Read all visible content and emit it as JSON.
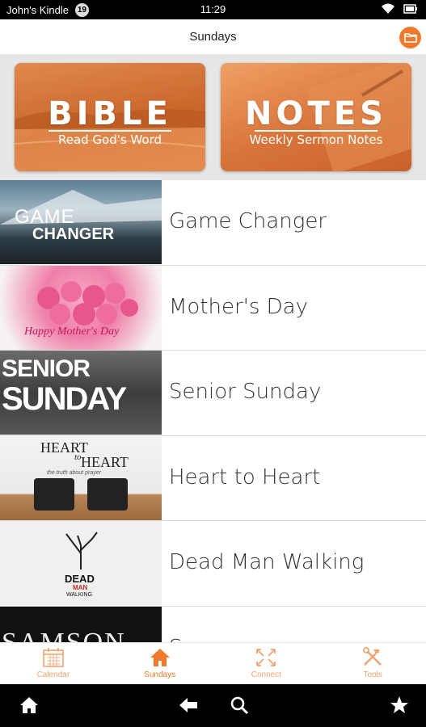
{
  "status_bar": {
    "device_name": "John's Kindle",
    "notification_count": "19",
    "time": "11:29"
  },
  "header": {
    "title": "Sundays",
    "folder_icon": "folder-icon"
  },
  "banner": {
    "bible": {
      "title": "BIBLE",
      "subtitle": "Read God's Word"
    },
    "notes": {
      "title": "NOTES",
      "subtitle": "Weekly Sermon Notes"
    }
  },
  "series": [
    {
      "label": "Game Changer",
      "thumb_text": [
        "GAME",
        "CHANGER"
      ]
    },
    {
      "label": "Mother's Day",
      "thumb_text": [
        "Happy Mother's Day"
      ]
    },
    {
      "label": "Senior Sunday",
      "thumb_text": [
        "SENIOR",
        "SUNDAY"
      ]
    },
    {
      "label": "Heart to Heart",
      "thumb_text": [
        "HEART",
        "to",
        "HEART",
        "the truth about prayer"
      ]
    },
    {
      "label": "Dead Man Walking",
      "thumb_text": [
        "DEAD",
        "MAN",
        "WALKING"
      ]
    },
    {
      "label": "Samson",
      "thumb_text": [
        "SAMSON"
      ]
    }
  ],
  "tabs": [
    {
      "label": "Calendar",
      "icon": "calendar-icon",
      "active": false
    },
    {
      "label": "Sundays",
      "icon": "home-icon",
      "active": true
    },
    {
      "label": "Connect",
      "icon": "connect-arrows-icon",
      "active": false
    },
    {
      "label": "Tools",
      "icon": "tools-icon",
      "active": false
    }
  ],
  "colors": {
    "accent": "#f07a2c",
    "accent_light": "#f0a46e",
    "banner_bg": "#e6e6e6"
  }
}
